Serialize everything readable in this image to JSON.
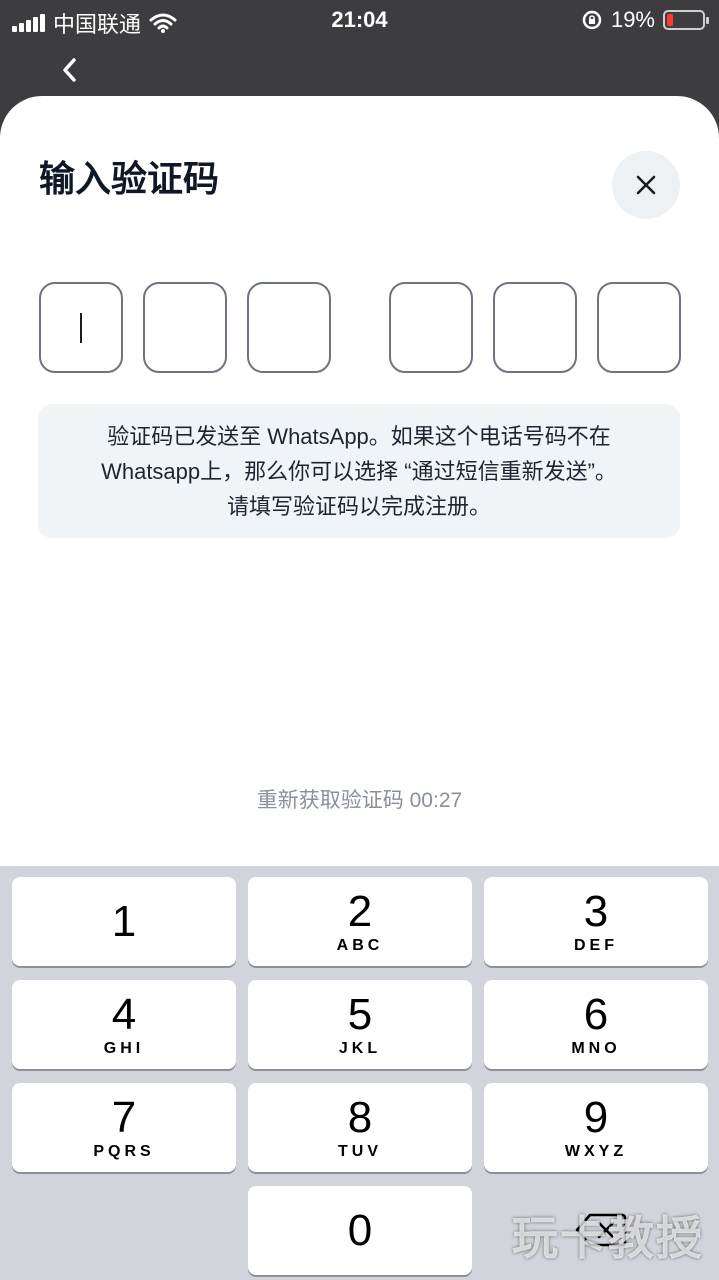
{
  "status_bar": {
    "carrier": "中国联通",
    "time": "21:04",
    "battery_percent": "19%",
    "battery_level": 0.19,
    "battery_color": "#ff3b30"
  },
  "nav": {
    "back_icon": "chevron-left-icon"
  },
  "sheet": {
    "title": "输入验证码",
    "close_icon": "close-icon",
    "otp_digits": [
      "",
      "",
      "",
      "",
      "",
      ""
    ],
    "info_lines": [
      "验证码已发送至 WhatsApp。如果这个电话号码不在",
      "Whatsapp上，那么你可以选择 “通过短信重新发送”。",
      "请填写验证码以完成注册。"
    ],
    "resend_text": "重新获取验证码 00:27"
  },
  "keypad": {
    "keys": [
      {
        "num": "1",
        "letters": ""
      },
      {
        "num": "2",
        "letters": "ABC"
      },
      {
        "num": "3",
        "letters": "DEF"
      },
      {
        "num": "4",
        "letters": "GHI"
      },
      {
        "num": "5",
        "letters": "JKL"
      },
      {
        "num": "6",
        "letters": "MNO"
      },
      {
        "num": "7",
        "letters": "PQRS"
      },
      {
        "num": "8",
        "letters": "TUV"
      },
      {
        "num": "9",
        "letters": "WXYZ"
      },
      {
        "num": "0",
        "letters": ""
      }
    ],
    "delete_icon": "backspace-icon"
  },
  "watermark": "玩卡教授"
}
